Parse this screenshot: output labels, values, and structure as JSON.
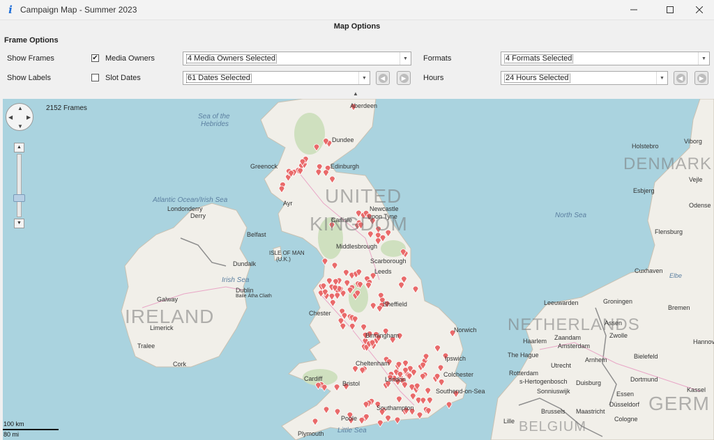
{
  "window": {
    "title": "Campaign Map - Summer 2023",
    "min_icon": "minimize-icon",
    "max_icon": "maximize-icon",
    "close_icon": "close-icon"
  },
  "options": {
    "title": "Map Options",
    "frame_options_label": "Frame Options",
    "show_frames_label": "Show Frames",
    "show_labels_label": "Show Labels",
    "media_owners_label": "Media Owners",
    "media_owners_checked": true,
    "slot_dates_label": "Slot Dates",
    "slot_dates_checked": false,
    "media_owners_value": "4 Media Owners Selected",
    "dates_value": "61 Dates Selected",
    "formats_label": "Formats",
    "formats_value": "4 Formats Selected",
    "hours_label": "Hours",
    "hours_value": "24 Hours Selected"
  },
  "map": {
    "frames_count": "2152 Frames",
    "scale_km": "100 km",
    "scale_mi": "80 mi",
    "pin_color": "#e96a6a",
    "land_color": "#f1efe9",
    "sea_color": "#aad3df",
    "countries": [
      "UNITED",
      "KINGDOM",
      "IRELAND",
      "NETHERLANDS",
      "DENMARK",
      "BELGIUM",
      "GERM"
    ],
    "seas": [
      "Sea of the",
      "Hebrides",
      "Atlantic Ocean/Irish Sea",
      "North Sea",
      "Irish Sea",
      "Little Sea"
    ],
    "places": [
      "Aberdeen",
      "Dundee",
      "Edinburgh",
      "Greenock",
      "Ayr",
      "Carlisle",
      "Newcastle",
      "upon Tyne",
      "Middlesbrough",
      "Scarborough",
      "Leeds",
      "Sheffield",
      "Chester",
      "Norwich",
      "Birmingham",
      "Cheltenham",
      "Ipswich",
      "Colchester",
      "Cardiff",
      "Bristol",
      "Southend-on-Sea",
      "London",
      "Southampton",
      "Poole",
      "Plymouth",
      "Londonderry",
      "Derry",
      "Belfast",
      "Dundalk",
      "Dublin",
      "Baile Átha Cliath",
      "Galway",
      "Limerick",
      "Tralee",
      "Cork",
      "ISLE OF MAN",
      "(U.K.)",
      "Holstebro",
      "Viborg",
      "Vejle",
      "Esbjerg",
      "Odense",
      "Flensburg",
      "Cuxhaven",
      "Bremen",
      "Leeuwarden",
      "Groningen",
      "Assen",
      "Zwolle",
      "Haarlem",
      "Zaandam",
      "Amsterdam",
      "The Hague",
      "Utrecht",
      "Arnhem",
      "Bielefeld",
      "Rotterdam",
      "s-Hertogenbosch",
      "Duisburg",
      "Dortmund",
      "Sonniuswijk",
      "Essen",
      "Kassel",
      "Brussels",
      "Maastricht",
      "Düsseldorf",
      "Cologne",
      "Lille",
      "Elbe",
      "Hannover"
    ]
  }
}
